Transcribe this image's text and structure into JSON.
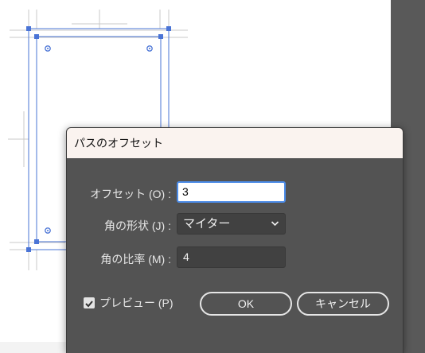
{
  "dialog": {
    "title": "パスのオフセット",
    "offset": {
      "label": "オフセット (O) :",
      "value": "3"
    },
    "corners": {
      "label": "角の形状 (J) :",
      "value": "マイター"
    },
    "miter_limit": {
      "label": "角の比率 (M) :",
      "value": "4"
    },
    "preview": {
      "label": "プレビュー (P)",
      "checked": true
    },
    "ok_label": "OK",
    "cancel_label": "キャンセル"
  },
  "colors": {
    "selection": "#4a74d6",
    "guides": "#c9c9c9",
    "dialog_bg": "#535353",
    "title_bg": "#faf3ef",
    "focus": "#4c8ce8"
  },
  "icons": [
    "chevron-down-icon",
    "checkbox-checked-icon",
    "anchor-point-icon"
  ]
}
